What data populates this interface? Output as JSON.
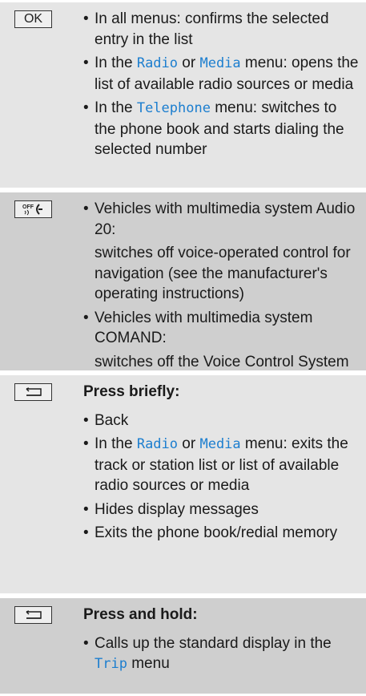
{
  "rows": [
    {
      "key": "OK",
      "icon": "ok-key",
      "items": [
        {
          "text": "In all menus: confirms the selected entry in the list"
        },
        {
          "pre": "In the ",
          "menu1": "Radio",
          "mid": " or ",
          "menu2": "Media",
          "post": " menu: opens the list of available radio sources or media"
        },
        {
          "pre": "In the ",
          "menu1": "Telephone",
          "post": " menu: switches to the phone book and starts dialing the selected number"
        }
      ]
    },
    {
      "icon": "voice-off-key",
      "items": [
        {
          "text": "Vehicles with multimedia system Audio 20:",
          "sub": "switches off voice-operated control for navigation (see the manufacturer's operating instructions)"
        },
        {
          "text": "Vehicles with multimedia system COMAND:",
          "sub": "switches off the Voice Control System (see the separate Operator's Manual)"
        }
      ]
    },
    {
      "icon": "back-key",
      "heading": "Press briefly:",
      "items": [
        {
          "text": "Back"
        },
        {
          "pre": "In the ",
          "menu1": "Radio",
          "mid": " or ",
          "menu2": "Media",
          "post": " menu: exits the track or station list or list of available radio sources or media"
        },
        {
          "text": "Hides display messages"
        },
        {
          "text": "Exits the phone book/redial memory"
        }
      ]
    },
    {
      "icon": "back-key",
      "heading": "Press and hold:",
      "items": [
        {
          "pre": "Calls up the standard display in the ",
          "menu1": "Trip",
          "post": " menu"
        }
      ]
    }
  ],
  "colors": {
    "menu_name": "#1c7ecf",
    "row_light": "#e5e5e5",
    "row_dark": "#cfcfcf"
  }
}
